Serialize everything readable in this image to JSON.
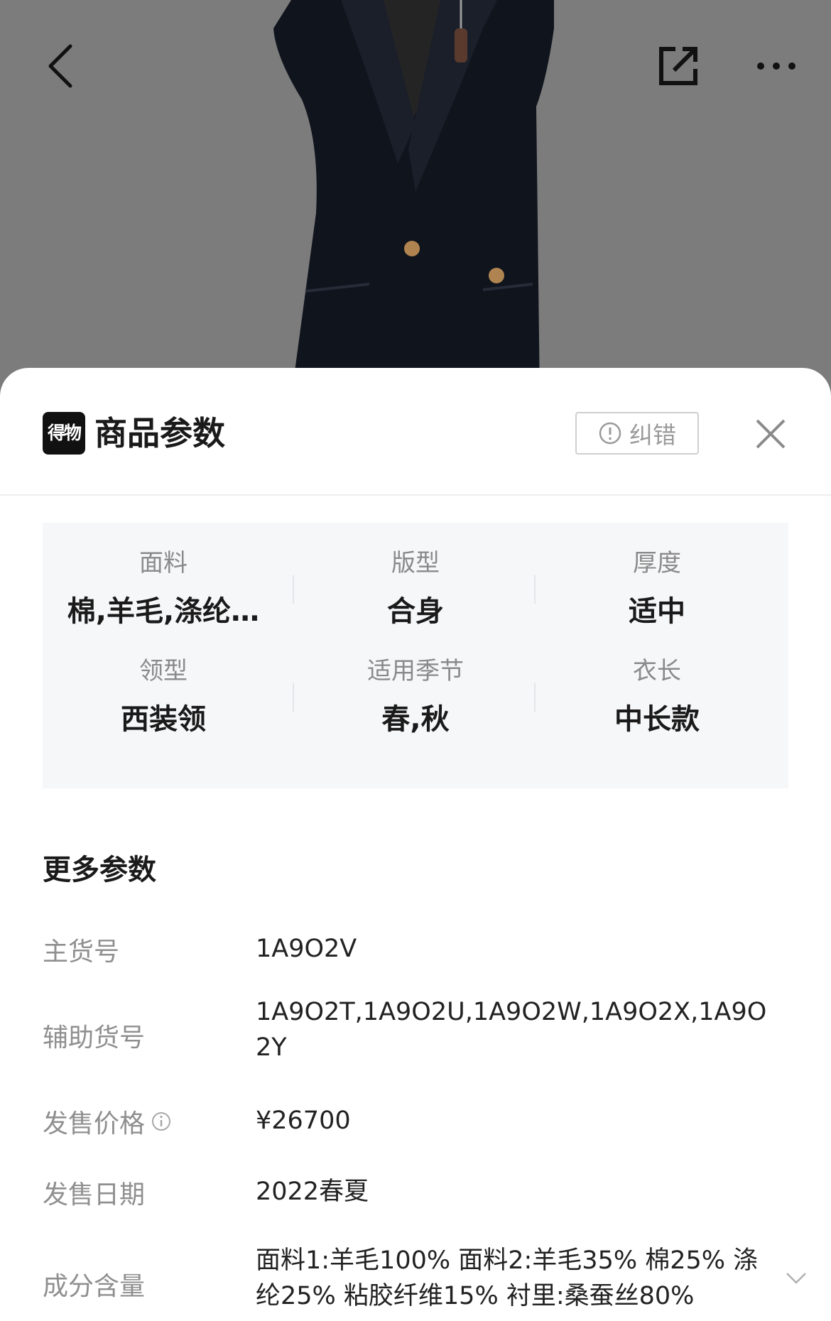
{
  "nav": {
    "back_icon": "chevron-left-icon",
    "share_icon": "share-external-icon",
    "more_icon": "more-dots-icon"
  },
  "sheet": {
    "logo_text": "得物",
    "title": "商品参数",
    "correct_label": "纠错",
    "correct_icon": "alert-circle-icon",
    "close_icon": "close-icon"
  },
  "summary": [
    {
      "label": "面料",
      "value": "棉,羊毛,涤纶…"
    },
    {
      "label": "版型",
      "value": "合身"
    },
    {
      "label": "厚度",
      "value": "适中"
    },
    {
      "label": "领型",
      "value": "西装领"
    },
    {
      "label": "适用季节",
      "value": "春,秋"
    },
    {
      "label": "衣长",
      "value": "中长款"
    }
  ],
  "more": {
    "title": "更多参数",
    "rows": [
      {
        "label": "主货号",
        "value": "1A9O2V"
      },
      {
        "label": "辅助货号",
        "value": "1A9O2T,1A9O2U,1A9O2W,1A9O2X,1A9O2Y"
      },
      {
        "label": "发售价格",
        "value": "¥26700",
        "info_icon": "info-icon"
      },
      {
        "label": "发售日期",
        "value": "2022春夏"
      },
      {
        "label": "成分含量",
        "value": "面料1:羊毛100% 面料2:羊毛35% 棉25% 涤纶25% 粘胶纤维15% 衬里:桑蚕丝80%",
        "expand_icon": "chevron-down-icon"
      }
    ]
  }
}
